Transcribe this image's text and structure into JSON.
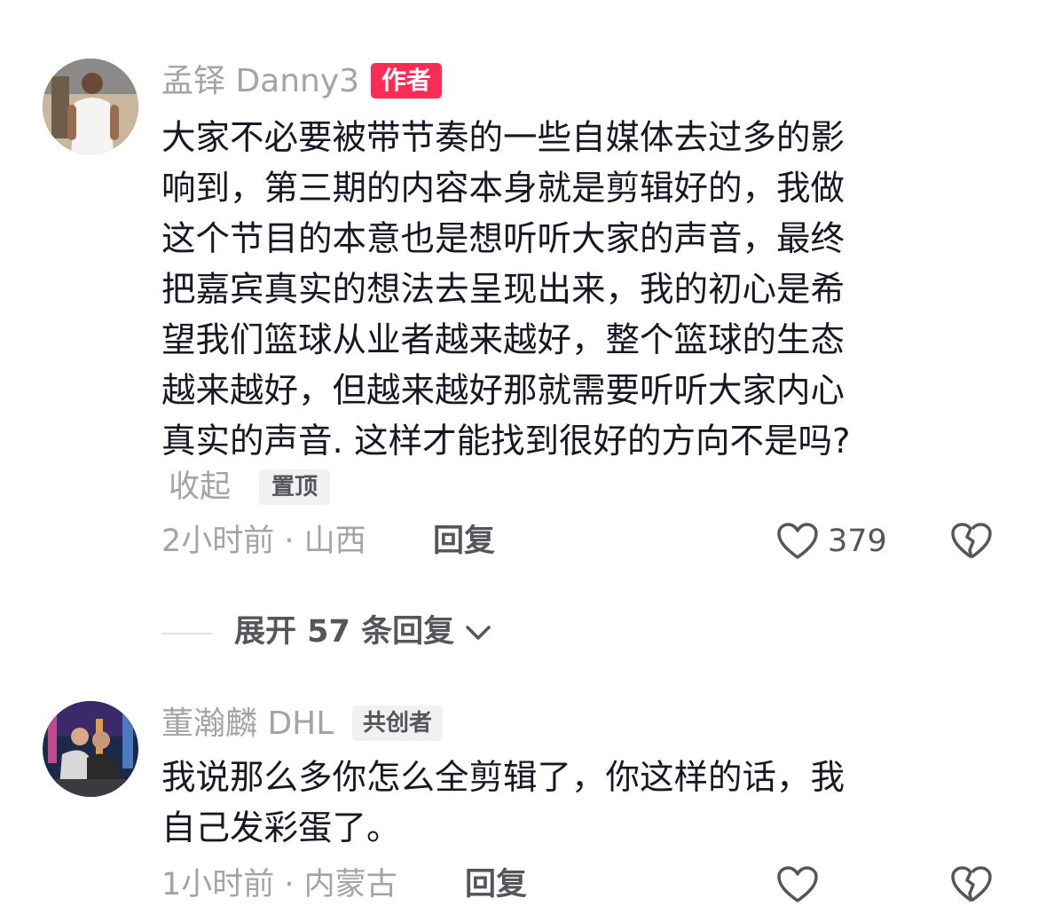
{
  "comments": [
    {
      "username": "孟铎 Danny3",
      "badge": "作者",
      "text_lines": [
        "大家不必要被带节奏的一些自媒体去过多的影",
        "响到，第三期的内容本身就是剪辑好的，我做",
        "这个节目的本意也是想听听大家的声音，最终",
        "把嘉宾真实的想法去呈现出来，我的初心是希",
        "望我们篮球从业者越来越好，整个篮球的生态",
        "越来越好，但越来越好那就需要听听大家内心",
        "真实的声音. 这样才能找到很好的方向不是吗?"
      ],
      "collapse_label": "收起",
      "pin_label": "置顶",
      "time_location": "2小时前 · 山西",
      "reply_label": "回复",
      "like_count": "379"
    },
    {
      "username": "董瀚麟 DHL",
      "badge": "共创者",
      "text_lines": [
        "我说那么多你怎么全剪辑了，你这样的话，我",
        "自己发彩蛋了。"
      ],
      "time_location": "1小时前 · 内蒙古",
      "reply_label": "回复",
      "like_count": ""
    }
  ],
  "expand_replies": {
    "label": "展开 57 条回复"
  },
  "colors": {
    "author_badge": "#fe2c55",
    "secondary_text": "#a3a3a8",
    "primary_text": "#161823"
  }
}
